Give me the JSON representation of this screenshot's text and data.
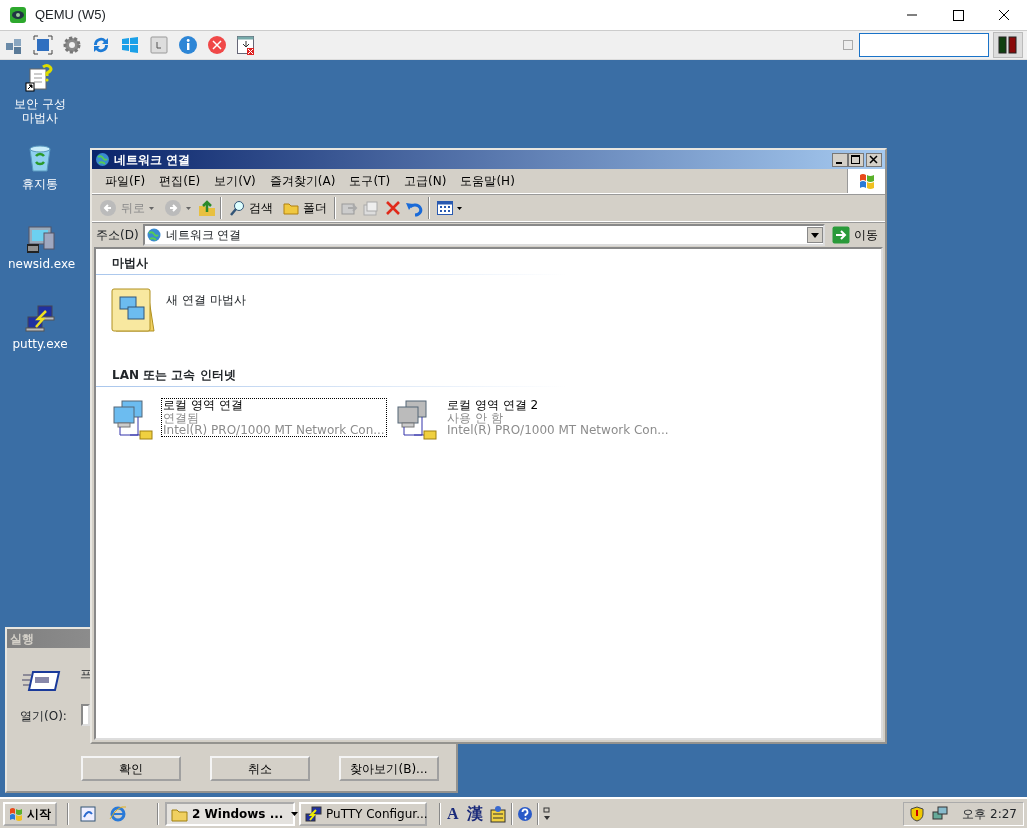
{
  "qemu": {
    "title": "QEMU (W5)"
  },
  "desktop_icons": [
    {
      "kind": "wizard",
      "label": "보안 구성 마법사"
    },
    {
      "kind": "recycle",
      "label": "휴지통"
    },
    {
      "kind": "newsid",
      "label": "newsid.exe"
    },
    {
      "kind": "putty",
      "label": "putty.exe"
    }
  ],
  "run_dialog": {
    "title": "실행",
    "prompt": "프",
    "open_label": "열기(O):",
    "buttons": [
      "확인",
      "취소",
      "찾아보기(B)..."
    ]
  },
  "explorer": {
    "title": "네트워크 연결",
    "menu": [
      "파일(F)",
      "편집(E)",
      "보기(V)",
      "즐겨찾기(A)",
      "도구(T)",
      "고급(N)",
      "도움말(H)"
    ],
    "toolbar": {
      "back": "뒤로",
      "search": "검색",
      "folders": "폴더"
    },
    "address": {
      "label": "주소(D)",
      "value": "네트워크 연결",
      "go": "이동"
    },
    "groups": [
      {
        "heading": "마법사",
        "items": [
          {
            "kind": "wizard",
            "name": "새 연결 마법사"
          }
        ]
      },
      {
        "heading": "LAN 또는 고속 인터넷",
        "items": [
          {
            "kind": "lan",
            "name": "로컬 영역 연결",
            "status": "연결됨",
            "device": "Intel(R) PRO/1000 MT Network Con...",
            "enabled": true,
            "selected": true
          },
          {
            "kind": "lan",
            "name": "로컬 영역 연결 2",
            "status": "사용 안 함",
            "device": "Intel(R) PRO/1000 MT Network Con...",
            "enabled": false,
            "selected": false
          }
        ]
      }
    ]
  },
  "taskbar": {
    "start": "시작",
    "tasks": [
      {
        "kind": "folder",
        "label": "2 Windows ...",
        "selected": true
      },
      {
        "kind": "putty",
        "label": "PuTTY Configur...",
        "selected": false
      }
    ],
    "language_bar": [
      "A",
      "漢"
    ],
    "clock": "오후 2:27"
  }
}
